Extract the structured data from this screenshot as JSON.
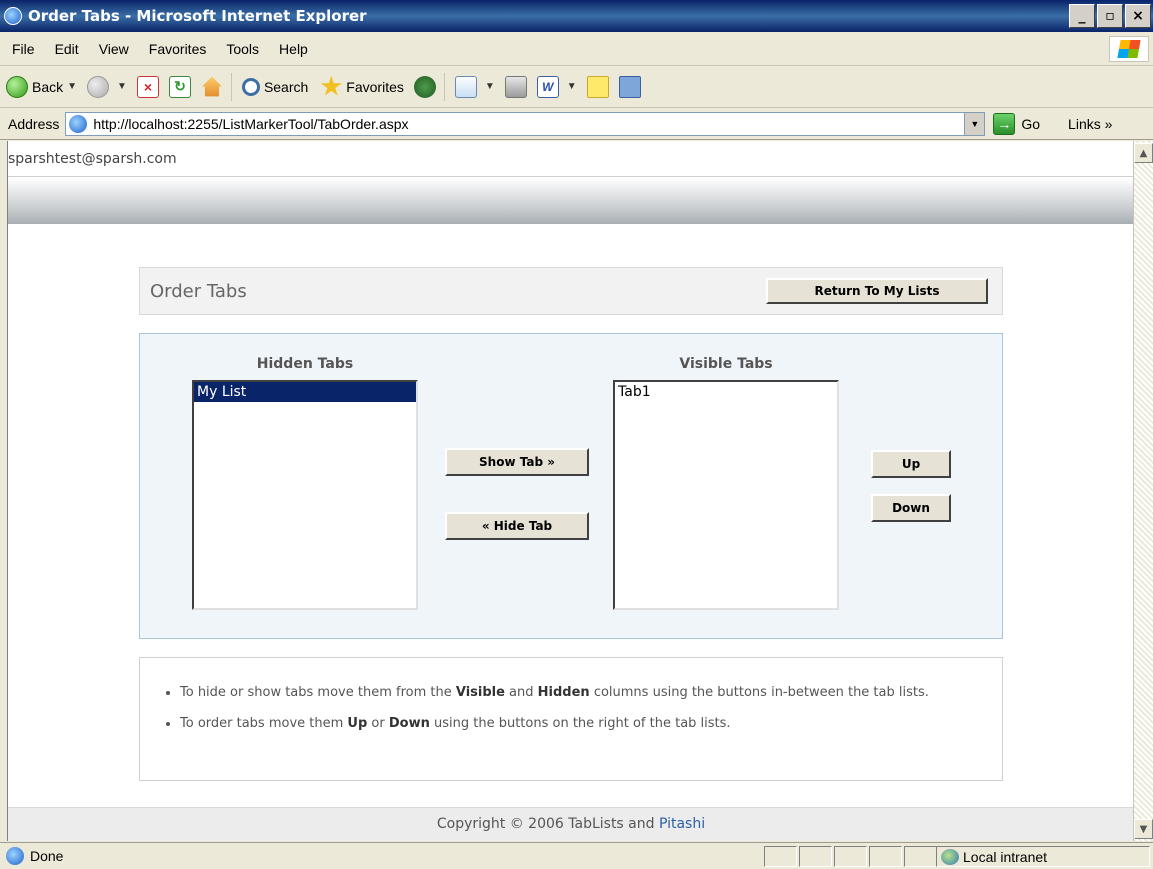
{
  "window": {
    "title": "Order Tabs - Microsoft Internet Explorer",
    "minimize": "_",
    "maximize": "▫",
    "close": "×"
  },
  "menu": [
    "File",
    "Edit",
    "View",
    "Favorites",
    "Tools",
    "Help"
  ],
  "toolbar": {
    "back": "Back",
    "search": "Search",
    "favorites": "Favorites",
    "stop_glyph": "×",
    "refresh_glyph": "↻",
    "word_glyph": "W"
  },
  "address": {
    "label": "Address",
    "url": "http://localhost:2255/ListMarkerTool/TabOrder.aspx",
    "go": "Go",
    "links": "Links »"
  },
  "page": {
    "user_email": "sparshtest@sparsh.com",
    "panel_title": "Order Tabs",
    "return_button": "Return To My Lists",
    "hidden_label": "Hidden Tabs",
    "visible_label": "Visible Tabs",
    "hidden_items": [
      "My List"
    ],
    "visible_items": [
      "Tab1"
    ],
    "show_tab": "Show Tab »",
    "hide_tab": "« Hide Tab",
    "up": "Up",
    "down": "Down",
    "info": {
      "line1_pre": "To hide or show tabs move them from the ",
      "line1_b1": "Visible",
      "line1_mid": " and ",
      "line1_b2": "Hidden",
      "line1_post": " columns using the buttons in-between the tab lists.",
      "line2_pre": "To order tabs move them ",
      "line2_b1": "Up",
      "line2_mid": " or ",
      "line2_b2": "Down",
      "line2_post": " using the buttons on the right of the tab lists."
    },
    "footer_text": "Copyright © 2006 TabLists and ",
    "footer_link": "Pitashi"
  },
  "status": {
    "text": "Done",
    "zone": "Local intranet"
  },
  "colors": {
    "selection": "#0a246a",
    "panel_border": "#a8c8e0",
    "link": "#2a5fa5"
  }
}
